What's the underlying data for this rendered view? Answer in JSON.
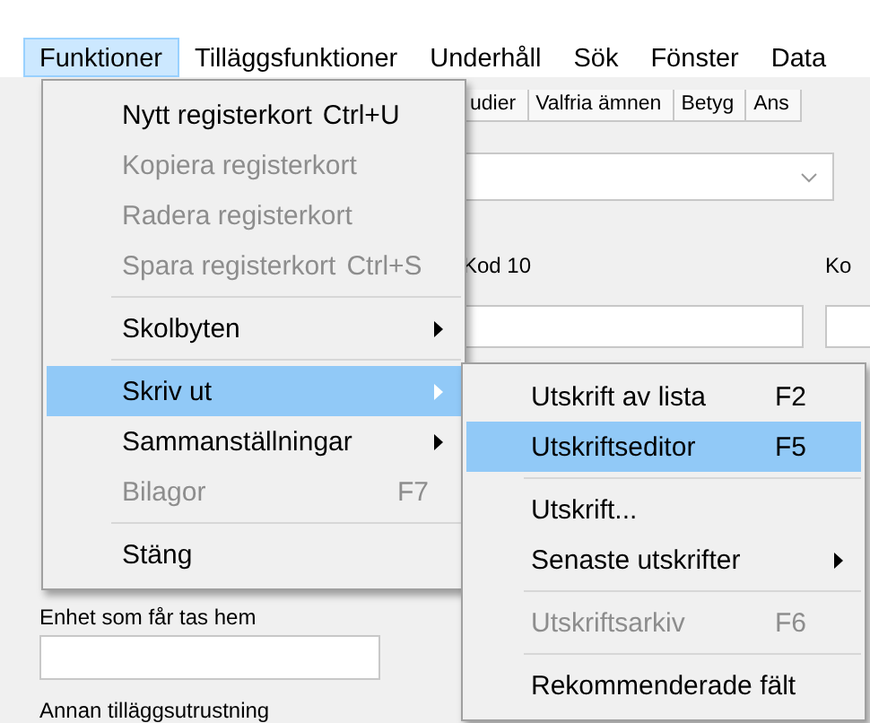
{
  "menubar": [
    {
      "label": "Funktioner",
      "selected": true
    },
    {
      "label": "Tilläggsfunktioner",
      "selected": false
    },
    {
      "label": "Underhåll",
      "selected": false
    },
    {
      "label": "Sök",
      "selected": false
    },
    {
      "label": "Fönster",
      "selected": false
    },
    {
      "label": "Data",
      "selected": false
    }
  ],
  "tabs": [
    {
      "label": "udier"
    },
    {
      "label": "Valfria ämnen"
    },
    {
      "label": "Betyg"
    },
    {
      "label": "Ans"
    }
  ],
  "form": {
    "field_1": {
      "label": "Kod 10"
    },
    "field_2": {
      "label": "Ko"
    },
    "field_3": {
      "label": "Enhet som får tas hem"
    },
    "field_4": {
      "label": "Annan tilläggsutrustning"
    }
  },
  "menu": [
    {
      "kind": "item",
      "label": "Nytt registerkort",
      "shortcut": "Ctrl+U",
      "disabled": false,
      "selected": false,
      "submenu": false
    },
    {
      "kind": "item",
      "label": "Kopiera registerkort",
      "disabled": true,
      "selected": false,
      "submenu": false
    },
    {
      "kind": "item",
      "label": "Radera registerkort",
      "disabled": true,
      "selected": false,
      "submenu": false
    },
    {
      "kind": "item",
      "label": "Spara registerkort",
      "shortcut": "Ctrl+S",
      "disabled": true,
      "selected": false,
      "submenu": false
    },
    {
      "kind": "separator"
    },
    {
      "kind": "item",
      "label": "Skolbyten",
      "disabled": false,
      "selected": false,
      "submenu": true
    },
    {
      "kind": "separator"
    },
    {
      "kind": "item",
      "label": "Skriv ut",
      "disabled": false,
      "selected": true,
      "submenu": true
    },
    {
      "kind": "item",
      "label": "Sammanställningar",
      "disabled": false,
      "selected": false,
      "submenu": true
    },
    {
      "kind": "item",
      "label": "Bilagor",
      "shortcut": "F7",
      "disabled": true,
      "selected": false,
      "submenu": false
    },
    {
      "kind": "separator"
    },
    {
      "kind": "item",
      "label": "Stäng",
      "disabled": false,
      "selected": false,
      "submenu": false
    }
  ],
  "submenu": [
    {
      "kind": "item",
      "label": "Utskrift av lista",
      "shortcut": "F2",
      "disabled": false,
      "selected": false,
      "submenu": false
    },
    {
      "kind": "item",
      "label": "Utskriftseditor",
      "shortcut": "F5",
      "disabled": false,
      "selected": true,
      "submenu": false
    },
    {
      "kind": "separator"
    },
    {
      "kind": "item",
      "label": "Utskrift...",
      "disabled": false,
      "selected": false,
      "submenu": false
    },
    {
      "kind": "item",
      "label": "Senaste utskrifter",
      "disabled": false,
      "selected": false,
      "submenu": true
    },
    {
      "kind": "separator"
    },
    {
      "kind": "item",
      "label": "Utskriftsarkiv",
      "shortcut": "F6",
      "disabled": true,
      "selected": false,
      "submenu": false
    },
    {
      "kind": "separator"
    },
    {
      "kind": "item",
      "label": "Rekommenderade fält",
      "disabled": false,
      "selected": false,
      "submenu": false
    }
  ]
}
